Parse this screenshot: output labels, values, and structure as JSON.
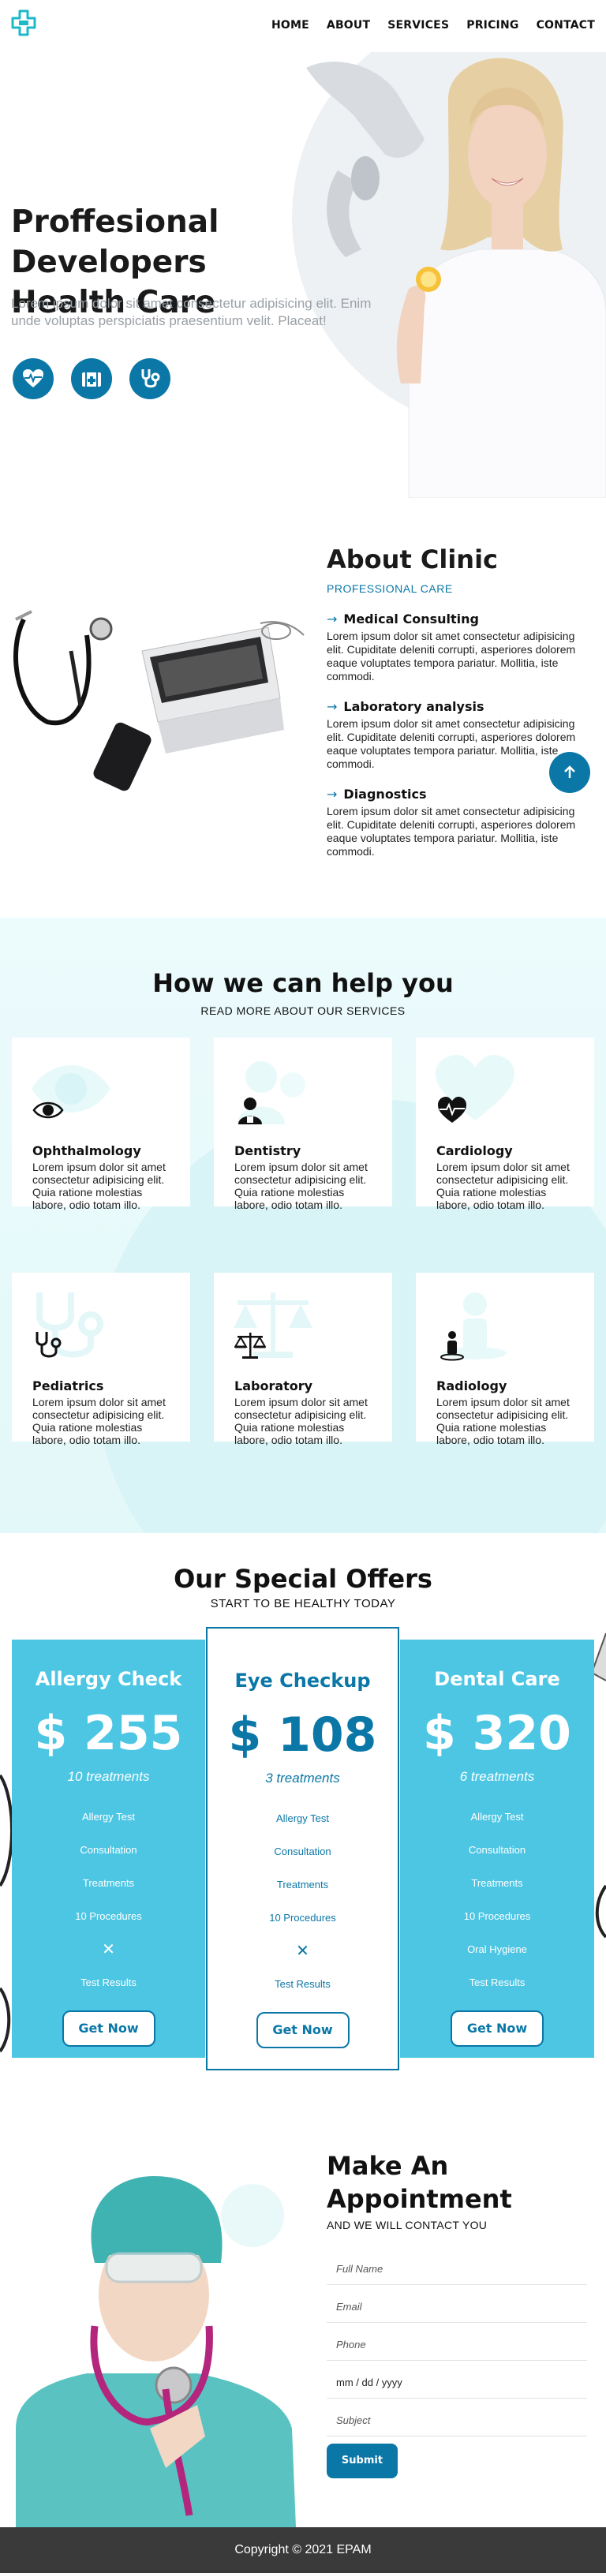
{
  "nav": {
    "items": [
      "HOME",
      "ABOUT",
      "SERVICES",
      "PRICING",
      "CONTACT"
    ]
  },
  "hero": {
    "title_line1": "Proffesional Developers",
    "title_line2": "Health Care",
    "text": "Lorem ipsum dolor sit amet consectetur adipisicing elit. Enim unde voluptas perspiciatis praesentium velit. Placeat!",
    "icons": [
      "heartbeat-icon",
      "hospital-icon",
      "stethoscope-icon"
    ]
  },
  "about": {
    "title": "About Clinic",
    "subtitle": "PROFESSIONAL CARE",
    "items": [
      {
        "title": "Medical Consulting",
        "text": "Lorem ipsum dolor sit amet consectetur adipisicing elit. Cupiditate deleniti corrupti, asperiores dolorem eaque voluptates tempora pariatur. Mollitia, iste commodi."
      },
      {
        "title": "Laboratory analysis",
        "text": "Lorem ipsum dolor sit amet consectetur adipisicing elit. Cupiditate deleniti corrupti, asperiores dolorem eaque voluptates tempora pariatur. Mollitia, iste commodi."
      },
      {
        "title": "Diagnostics",
        "text": "Lorem ipsum dolor sit amet consectetur adipisicing elit. Cupiditate deleniti corrupti, asperiores dolorem eaque voluptates tempora pariatur. Mollitia, iste commodi."
      }
    ]
  },
  "services": {
    "title": "How we can help you",
    "subtitle": "READ MORE ABOUT OUR SERVICES",
    "cards": [
      {
        "name": "Ophthalmology",
        "icon": "eye-icon",
        "text": "Lorem ipsum dolor sit amet consectetur adipisicing elit. Quia ratione molestias labore, odio totam illo."
      },
      {
        "name": "Dentistry",
        "icon": "dentist-icon",
        "text": "Lorem ipsum dolor sit amet consectetur adipisicing elit. Quia ratione molestias labore, odio totam illo."
      },
      {
        "name": "Cardiology",
        "icon": "heartbeat-icon",
        "text": "Lorem ipsum dolor sit amet consectetur adipisicing elit. Quia ratione molestias labore, odio totam illo."
      },
      {
        "name": "Pediatrics",
        "icon": "stethoscope-icon",
        "text": "Lorem ipsum dolor sit amet consectetur adipisicing elit. Quia ratione molestias labore, odio totam illo."
      },
      {
        "name": "Laboratory",
        "icon": "balance-scale-icon",
        "text": "Lorem ipsum dolor sit amet consectetur adipisicing elit. Quia ratione molestias labore, odio totam illo."
      },
      {
        "name": "Radiology",
        "icon": "person-radiology-icon",
        "text": "Lorem ipsum dolor sit amet consectetur adipisicing elit. Quia ratione molestias labore, odio totam illo."
      }
    ]
  },
  "offers": {
    "title": "Our Special Offers",
    "subtitle": "START TO BE HEALTHY TODAY",
    "plans": [
      {
        "name": "Allergy Check",
        "price": "$ 255",
        "treatments": "10 treatments",
        "features": [
          "Allergy Test",
          "Consultation",
          "Treatments",
          "10 Procedures",
          "✕",
          "Test Results"
        ],
        "button": "Get Now"
      },
      {
        "name": "Eye Checkup",
        "price": "$ 108",
        "treatments": "3 treatments",
        "features": [
          "Allergy Test",
          "Consultation",
          "Treatments",
          "10 Procedures",
          "✕",
          "Test Results"
        ],
        "button": "Get Now"
      },
      {
        "name": "Dental Care",
        "price": "$ 320",
        "treatments": "6 treatments",
        "features": [
          "Allergy Test",
          "Consultation",
          "Treatments",
          "10 Procedures",
          "Oral Hygiene",
          "Test Results"
        ],
        "button": "Get Now"
      }
    ]
  },
  "appointment": {
    "title_line1": "Make An",
    "title_line2": "Appointment",
    "subtitle": "AND WE WILL CONTACT YOU",
    "fields": [
      "Full Name",
      "Email",
      "Phone",
      "mm / dd / yyyy",
      "Subject"
    ],
    "submit": "Submit"
  },
  "footer": {
    "text": "Copyright © 2021 EPAM"
  },
  "colors": {
    "primary": "#0a77a7",
    "teal": "#4dc6e4",
    "logo": "#1fb8c9"
  }
}
